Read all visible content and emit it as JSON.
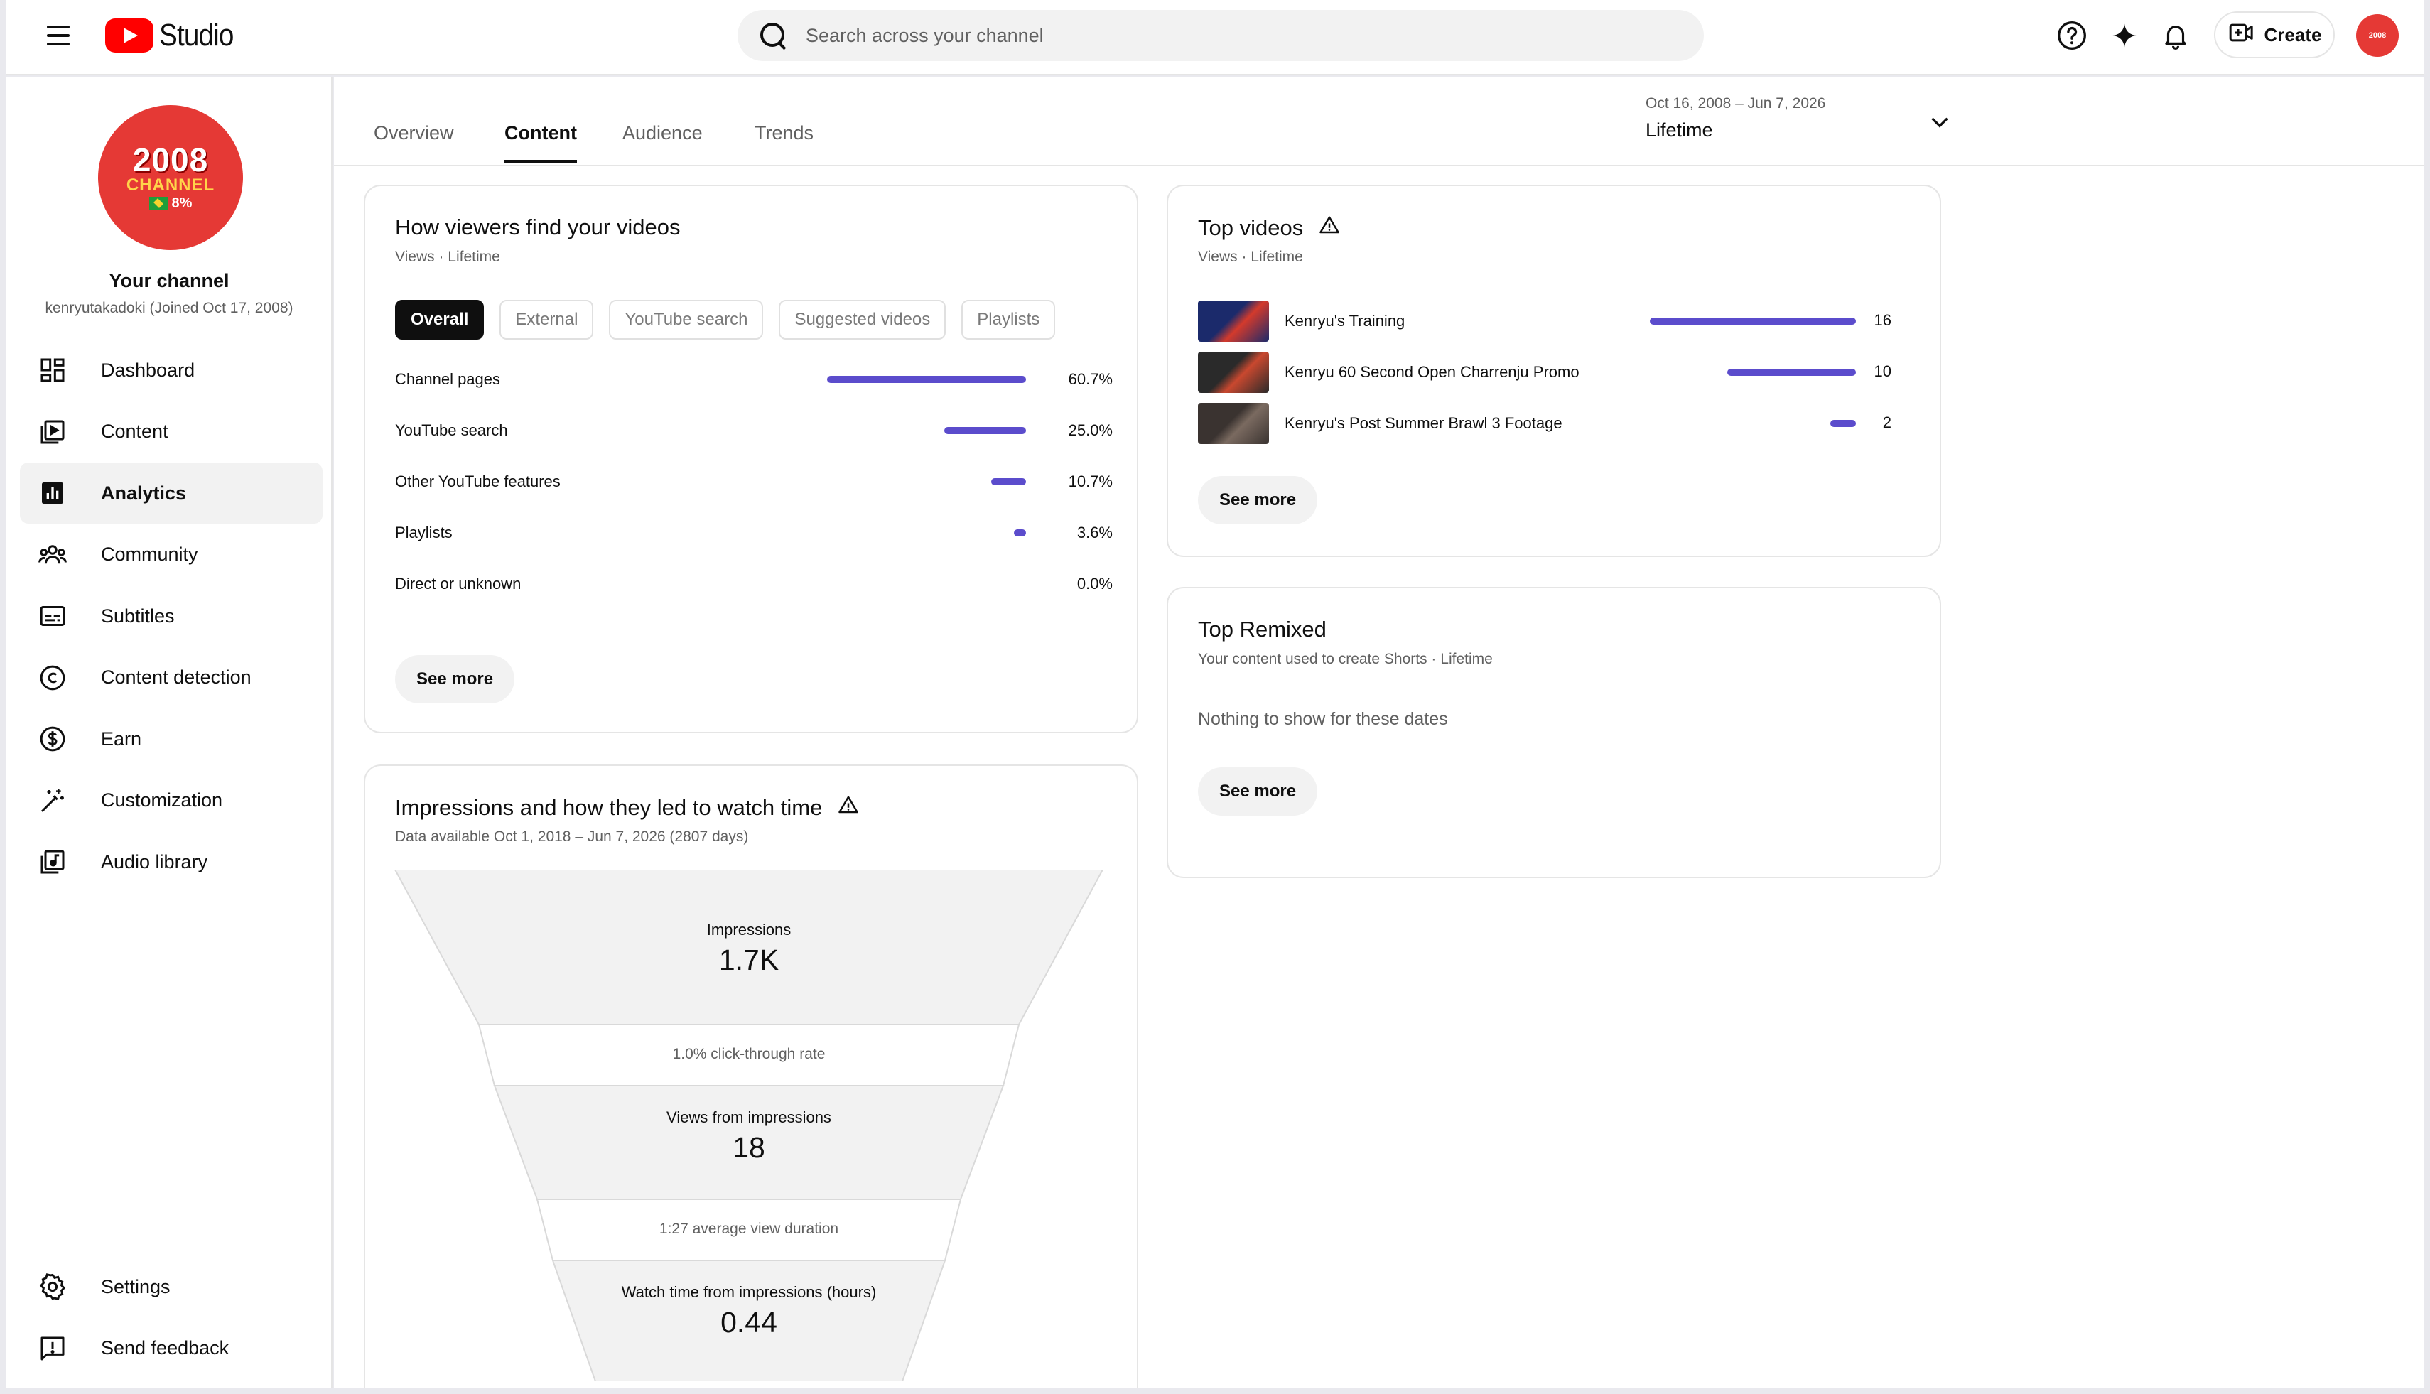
{
  "topbar": {
    "logo_text": "Studio",
    "search_placeholder": "Search across your channel",
    "create_label": "Create",
    "icons": [
      "menu-icon",
      "help-icon",
      "sparkle-icon",
      "bell-icon",
      "create-video-icon"
    ]
  },
  "sidebar": {
    "avatar": {
      "year": "2008",
      "channel": "CHANNEL",
      "percent": "8%"
    },
    "title": "Your channel",
    "handle": "kenryutakadoki (Joined Oct 17, 2008)",
    "items": [
      {
        "label": "Dashboard",
        "icon": "dashboard-icon"
      },
      {
        "label": "Content",
        "icon": "content-icon"
      },
      {
        "label": "Analytics",
        "icon": "analytics-icon",
        "active": true
      },
      {
        "label": "Community",
        "icon": "community-icon"
      },
      {
        "label": "Subtitles",
        "icon": "subtitles-icon"
      },
      {
        "label": "Content detection",
        "icon": "copyright-icon"
      },
      {
        "label": "Earn",
        "icon": "dollar-icon"
      },
      {
        "label": "Customization",
        "icon": "magic-wand-icon"
      },
      {
        "label": "Audio library",
        "icon": "audio-library-icon"
      }
    ],
    "bottom_items": [
      {
        "label": "Settings",
        "icon": "gear-icon"
      },
      {
        "label": "Send feedback",
        "icon": "feedback-icon"
      }
    ]
  },
  "tabs": [
    {
      "label": "Overview"
    },
    {
      "label": "Content",
      "active": true
    },
    {
      "label": "Audience"
    },
    {
      "label": "Trends"
    }
  ],
  "date_range": {
    "range": "Oct 16, 2008 – Jun 7, 2026",
    "label": "Lifetime"
  },
  "colors": {
    "accent_bar": "#5b4ccc",
    "brand_red": "#ff0000"
  },
  "traffic": {
    "title": "How viewers find your videos",
    "subtitle": "Views · Lifetime",
    "chips": [
      {
        "label": "Overall",
        "active": true
      },
      {
        "label": "External"
      },
      {
        "label": "YouTube search"
      },
      {
        "label": "Suggested videos"
      },
      {
        "label": "Playlists"
      }
    ],
    "rows": [
      {
        "label": "Channel pages",
        "value": "60.7%",
        "fraction": 0.607
      },
      {
        "label": "YouTube search",
        "value": "25.0%",
        "fraction": 0.25
      },
      {
        "label": "Other YouTube features",
        "value": "10.7%",
        "fraction": 0.107
      },
      {
        "label": "Playlists",
        "value": "3.6%",
        "fraction": 0.036
      },
      {
        "label": "Direct or unknown",
        "value": "0.0%",
        "fraction": 0.0
      }
    ],
    "see_more": "See more"
  },
  "impressions": {
    "title": "Impressions and how they led to watch time",
    "subtitle": "Data available Oct 1, 2018 – Jun 7, 2026 (2807 days)",
    "impressions_label": "Impressions",
    "impressions_value": "1.7K",
    "ctr": "1.0% click-through rate",
    "views_label": "Views from impressions",
    "views_value": "18",
    "avd": "1:27 average view duration",
    "watch_label": "Watch time from impressions (hours)",
    "watch_value": "0.44"
  },
  "top_videos": {
    "title": "Top videos",
    "subtitle": "Views · Lifetime",
    "items": [
      {
        "title": "Kenryu's Training",
        "views": "16",
        "fraction": 1.0
      },
      {
        "title": "Kenryu 60 Second Open Charrenju Promo",
        "views": "10",
        "fraction": 0.625
      },
      {
        "title": "Kenryu's Post Summer Brawl 3 Footage",
        "views": "2",
        "fraction": 0.125
      }
    ],
    "see_more": "See more"
  },
  "top_remixed": {
    "title": "Top Remixed",
    "subtitle": "Your content used to create Shorts · Lifetime",
    "empty": "Nothing to show for these dates",
    "see_more": "See more"
  }
}
